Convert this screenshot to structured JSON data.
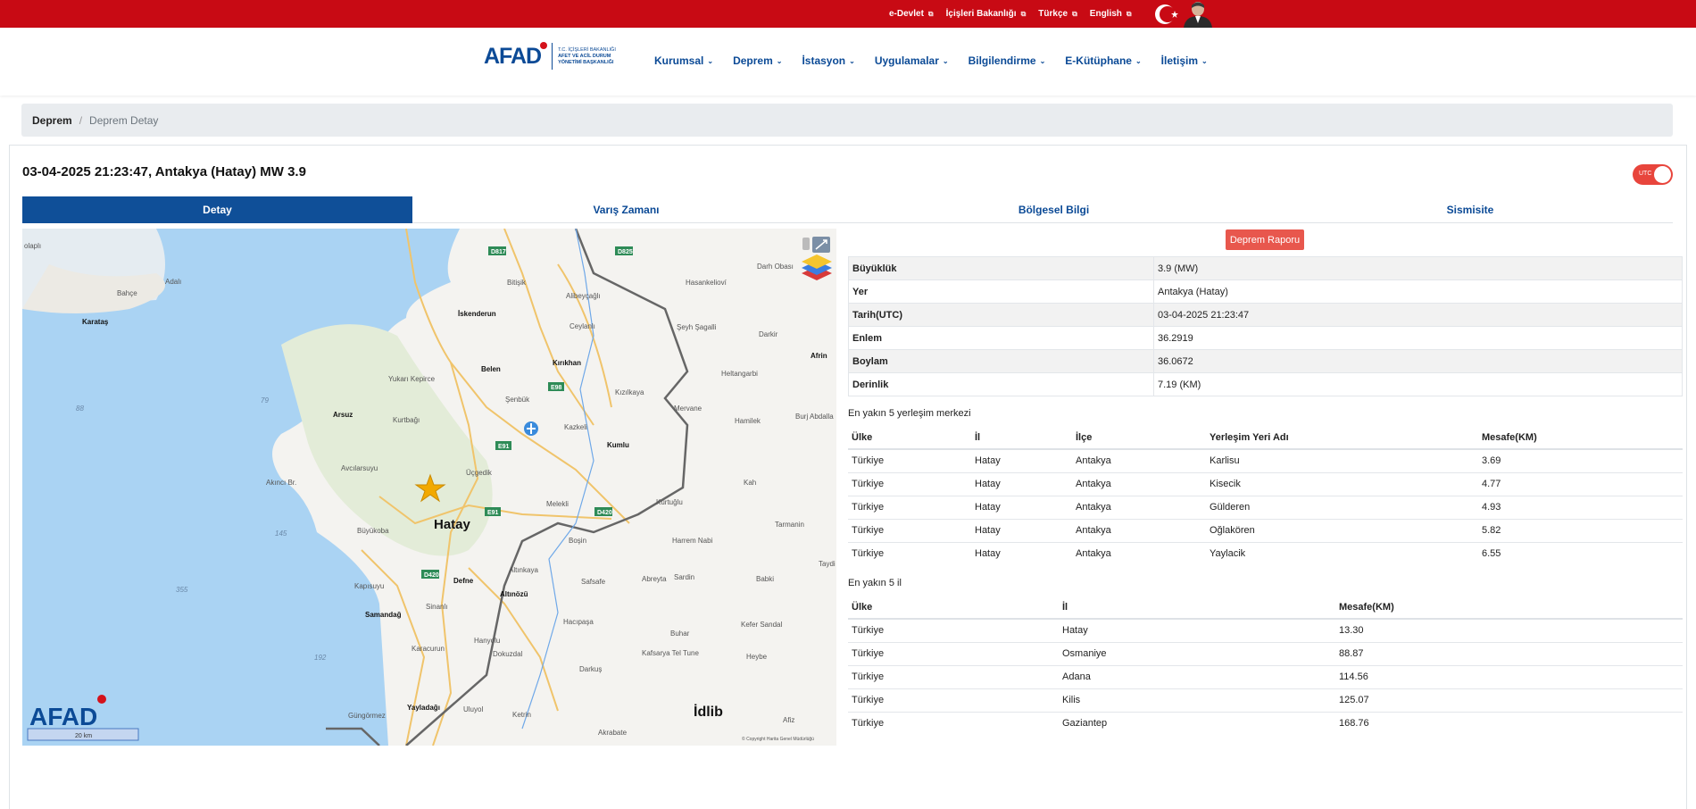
{
  "topbar": {
    "links": [
      "e-Devlet",
      "İçişleri Bakanlığı",
      "Türkçe",
      "English"
    ],
    "color": "#c80a14"
  },
  "logo": {
    "text": "AFAD",
    "subtitle": [
      "T.C. İÇİŞLERİ BAKANLIĞI",
      "AFET VE ACİL DURUM",
      "YÖNETİMİ BAŞKANLIĞI"
    ]
  },
  "nav": [
    "Kurumsal",
    "Deprem",
    "İstasyon",
    "Uygulamalar",
    "Bilgilendirme",
    "E-Kütüphane",
    "İletişim"
  ],
  "breadcrumb": {
    "home": "Deprem",
    "current": "Deprem Detay"
  },
  "title": "03-04-2025 21:23:47, Antakya (Hatay) MW 3.9",
  "utc_toggle": {
    "label": "UTC",
    "on": true
  },
  "tabs": [
    "Detay",
    "Varış Zamanı",
    "Bölgesel Bilgi",
    "Sismisite"
  ],
  "active_tab": "Detay",
  "report_button": "Deprem Raporu",
  "details": [
    {
      "key": "Büyüklük",
      "value": "3.9 (MW)"
    },
    {
      "key": "Yer",
      "value": "Antakya (Hatay)"
    },
    {
      "key": "Tarih(UTC)",
      "value": "03-04-2025 21:23:47"
    },
    {
      "key": "Enlem",
      "value": "36.2919"
    },
    {
      "key": "Boylam",
      "value": "36.0672"
    },
    {
      "key": "Derinlik",
      "value": "7.19 (KM)"
    }
  ],
  "nearest_settlements": {
    "title": "En yakın 5 yerleşim merkezi",
    "headers": [
      "Ülke",
      "İl",
      "İlçe",
      "Yerleşim Yeri Adı",
      "Mesafe(KM)"
    ],
    "rows": [
      [
        "Türkiye",
        "Hatay",
        "Antakya",
        "Karlisu",
        "3.69"
      ],
      [
        "Türkiye",
        "Hatay",
        "Antakya",
        "Kisecik",
        "4.77"
      ],
      [
        "Türkiye",
        "Hatay",
        "Antakya",
        "Gülderen",
        "4.93"
      ],
      [
        "Türkiye",
        "Hatay",
        "Antakya",
        "Oğlakören",
        "5.82"
      ],
      [
        "Türkiye",
        "Hatay",
        "Antakya",
        "Yaylacik",
        "6.55"
      ]
    ]
  },
  "nearest_provinces": {
    "title": "En yakın 5 il",
    "headers": [
      "Ülke",
      "İl",
      "Mesafe(KM)"
    ],
    "rows": [
      [
        "Türkiye",
        "Hatay",
        "13.30"
      ],
      [
        "Türkiye",
        "Osmaniye",
        "88.87"
      ],
      [
        "Türkiye",
        "Adana",
        "114.56"
      ],
      [
        "Türkiye",
        "Kilis",
        "125.07"
      ],
      [
        "Türkiye",
        "Gaziantep",
        "168.76"
      ]
    ]
  },
  "map": {
    "places": [
      "olaplı",
      "Bahçe",
      "Adalı",
      "Karataş",
      "İskenderun",
      "Bitişik",
      "Alibeyçağlı",
      "Hasankeliovi",
      "Darh Obası",
      "Ceylanlı",
      "Şeyh Şagalli",
      "Darkir",
      "Afrin",
      "Belen",
      "Kırıkhan",
      "Yukarı Kepirce",
      "Heltangarbi",
      "Kızılkaya",
      "Şenbük",
      "Mervane",
      "Burj Abdalla",
      "Arsuz",
      "Kurtbağı",
      "Hamilek",
      "Kazkeli",
      "Kumlu",
      "Akıncı Br.",
      "Avcılarsuyu",
      "Üçgedik",
      "Kah",
      "Melekli",
      "Kurtuğlu",
      "Tarmanin",
      "Hatay",
      "Büyükoba",
      "Harrem Nabi",
      "Boşin",
      "Taydi",
      "Defne",
      "Altınkaya",
      "Sardin",
      "Babki",
      "Kapısuyu",
      "Altınözü",
      "Abreyta",
      "Samandağ",
      "Sinanlı",
      "Safsafe",
      "Kefer Sandal",
      "Hacıpaşa",
      "Karacurun",
      "Hanyolu",
      "Buhar",
      "Kafsarya Tel Tune",
      "Heybe",
      "Dokuzdal",
      "Darkuş",
      "Yayladağı",
      "Uluyol",
      "İdlib",
      "Afiz",
      "Güngörmez",
      "Ketrin",
      "Akrabate"
    ],
    "roads": [
      "D817",
      "D825",
      "E98",
      "E91",
      "D420"
    ],
    "sea_depths": [
      "88",
      "79",
      "145",
      "355",
      "192"
    ],
    "scale": "20 km",
    "copyright": "© Copyright Harita Genel Müdürlüğü",
    "watermark": "AFAD"
  }
}
